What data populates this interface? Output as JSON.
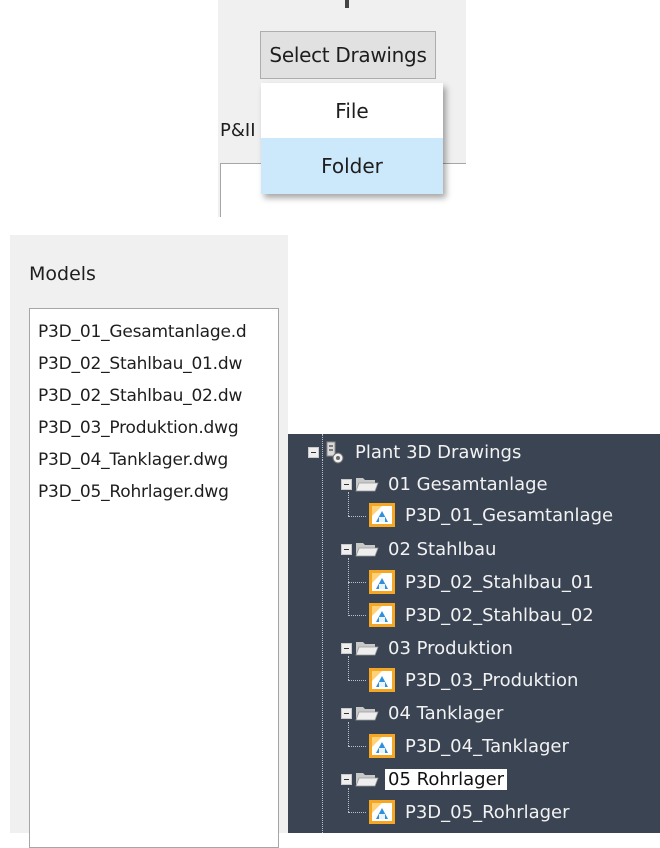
{
  "select_drawings": {
    "button_label": "Select Drawings",
    "menu": [
      {
        "label": "File",
        "highlighted": false
      },
      {
        "label": "Folder",
        "highlighted": true
      }
    ],
    "pid_label": "P&II"
  },
  "models": {
    "label": "Models",
    "items": [
      "P3D_01_Gesamtanlage.d",
      "P3D_02_Stahlbau_01.dw",
      "P3D_02_Stahlbau_02.dw",
      "P3D_03_Produktion.dwg",
      "P3D_04_Tanklager.dwg",
      "P3D_05_Rohrlager.dwg"
    ]
  },
  "tree": {
    "root": "Plant 3D Drawings",
    "folders": [
      {
        "label": "01 Gesamtanlage",
        "children": [
          "P3D_01_Gesamtanlage"
        ]
      },
      {
        "label": "02 Stahlbau",
        "children": [
          "P3D_02_Stahlbau_01",
          "P3D_02_Stahlbau_02"
        ]
      },
      {
        "label": "03 Produktion",
        "children": [
          "P3D_03_Produktion"
        ]
      },
      {
        "label": "04 Tanklager",
        "children": [
          "P3D_04_Tanklager"
        ]
      },
      {
        "label": "05 Rohrlager",
        "children": [
          "P3D_05_Rohrlager"
        ],
        "selected": true
      }
    ]
  },
  "colors": {
    "menu_highlight": "#cce8fb",
    "tree_background": "#3b4453",
    "dialog_background": "#f0f0f0"
  },
  "icons": {
    "root": "plant-project-icon",
    "folder": "folder-open-icon",
    "drawing": "dwg-file-icon",
    "expander": "collapse-minus-icon"
  }
}
